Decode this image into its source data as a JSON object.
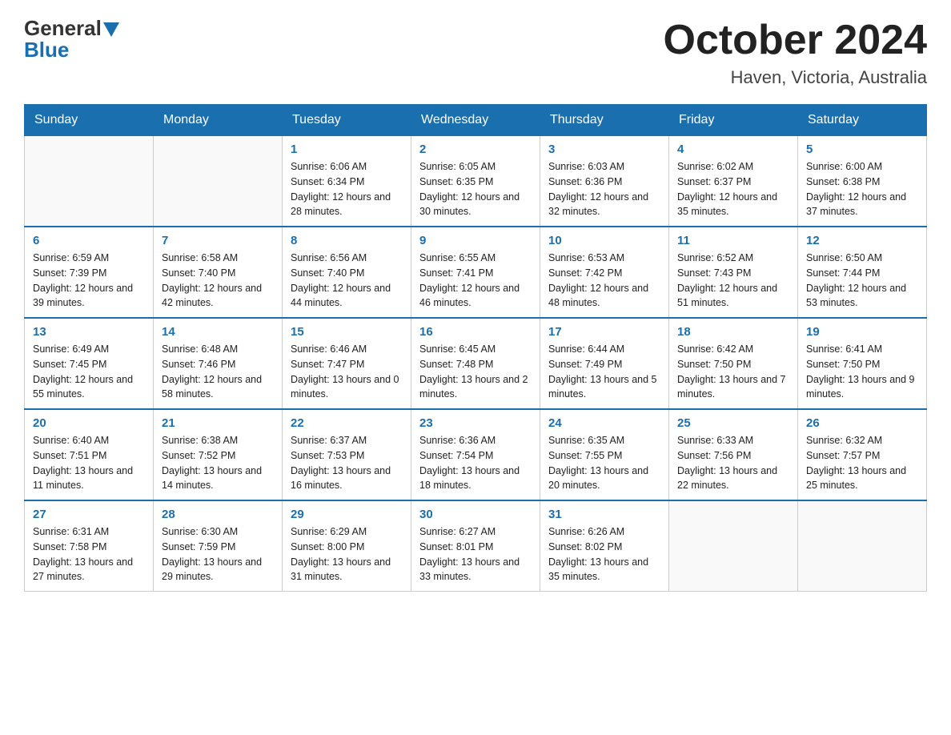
{
  "header": {
    "logo_general": "General",
    "logo_blue": "Blue",
    "month": "October 2024",
    "location": "Haven, Victoria, Australia"
  },
  "weekdays": [
    "Sunday",
    "Monday",
    "Tuesday",
    "Wednesday",
    "Thursday",
    "Friday",
    "Saturday"
  ],
  "weeks": [
    [
      {
        "day": "",
        "sunrise": "",
        "sunset": "",
        "daylight": ""
      },
      {
        "day": "",
        "sunrise": "",
        "sunset": "",
        "daylight": ""
      },
      {
        "day": "1",
        "sunrise": "Sunrise: 6:06 AM",
        "sunset": "Sunset: 6:34 PM",
        "daylight": "Daylight: 12 hours and 28 minutes."
      },
      {
        "day": "2",
        "sunrise": "Sunrise: 6:05 AM",
        "sunset": "Sunset: 6:35 PM",
        "daylight": "Daylight: 12 hours and 30 minutes."
      },
      {
        "day": "3",
        "sunrise": "Sunrise: 6:03 AM",
        "sunset": "Sunset: 6:36 PM",
        "daylight": "Daylight: 12 hours and 32 minutes."
      },
      {
        "day": "4",
        "sunrise": "Sunrise: 6:02 AM",
        "sunset": "Sunset: 6:37 PM",
        "daylight": "Daylight: 12 hours and 35 minutes."
      },
      {
        "day": "5",
        "sunrise": "Sunrise: 6:00 AM",
        "sunset": "Sunset: 6:38 PM",
        "daylight": "Daylight: 12 hours and 37 minutes."
      }
    ],
    [
      {
        "day": "6",
        "sunrise": "Sunrise: 6:59 AM",
        "sunset": "Sunset: 7:39 PM",
        "daylight": "Daylight: 12 hours and 39 minutes."
      },
      {
        "day": "7",
        "sunrise": "Sunrise: 6:58 AM",
        "sunset": "Sunset: 7:40 PM",
        "daylight": "Daylight: 12 hours and 42 minutes."
      },
      {
        "day": "8",
        "sunrise": "Sunrise: 6:56 AM",
        "sunset": "Sunset: 7:40 PM",
        "daylight": "Daylight: 12 hours and 44 minutes."
      },
      {
        "day": "9",
        "sunrise": "Sunrise: 6:55 AM",
        "sunset": "Sunset: 7:41 PM",
        "daylight": "Daylight: 12 hours and 46 minutes."
      },
      {
        "day": "10",
        "sunrise": "Sunrise: 6:53 AM",
        "sunset": "Sunset: 7:42 PM",
        "daylight": "Daylight: 12 hours and 48 minutes."
      },
      {
        "day": "11",
        "sunrise": "Sunrise: 6:52 AM",
        "sunset": "Sunset: 7:43 PM",
        "daylight": "Daylight: 12 hours and 51 minutes."
      },
      {
        "day": "12",
        "sunrise": "Sunrise: 6:50 AM",
        "sunset": "Sunset: 7:44 PM",
        "daylight": "Daylight: 12 hours and 53 minutes."
      }
    ],
    [
      {
        "day": "13",
        "sunrise": "Sunrise: 6:49 AM",
        "sunset": "Sunset: 7:45 PM",
        "daylight": "Daylight: 12 hours and 55 minutes."
      },
      {
        "day": "14",
        "sunrise": "Sunrise: 6:48 AM",
        "sunset": "Sunset: 7:46 PM",
        "daylight": "Daylight: 12 hours and 58 minutes."
      },
      {
        "day": "15",
        "sunrise": "Sunrise: 6:46 AM",
        "sunset": "Sunset: 7:47 PM",
        "daylight": "Daylight: 13 hours and 0 minutes."
      },
      {
        "day": "16",
        "sunrise": "Sunrise: 6:45 AM",
        "sunset": "Sunset: 7:48 PM",
        "daylight": "Daylight: 13 hours and 2 minutes."
      },
      {
        "day": "17",
        "sunrise": "Sunrise: 6:44 AM",
        "sunset": "Sunset: 7:49 PM",
        "daylight": "Daylight: 13 hours and 5 minutes."
      },
      {
        "day": "18",
        "sunrise": "Sunrise: 6:42 AM",
        "sunset": "Sunset: 7:50 PM",
        "daylight": "Daylight: 13 hours and 7 minutes."
      },
      {
        "day": "19",
        "sunrise": "Sunrise: 6:41 AM",
        "sunset": "Sunset: 7:50 PM",
        "daylight": "Daylight: 13 hours and 9 minutes."
      }
    ],
    [
      {
        "day": "20",
        "sunrise": "Sunrise: 6:40 AM",
        "sunset": "Sunset: 7:51 PM",
        "daylight": "Daylight: 13 hours and 11 minutes."
      },
      {
        "day": "21",
        "sunrise": "Sunrise: 6:38 AM",
        "sunset": "Sunset: 7:52 PM",
        "daylight": "Daylight: 13 hours and 14 minutes."
      },
      {
        "day": "22",
        "sunrise": "Sunrise: 6:37 AM",
        "sunset": "Sunset: 7:53 PM",
        "daylight": "Daylight: 13 hours and 16 minutes."
      },
      {
        "day": "23",
        "sunrise": "Sunrise: 6:36 AM",
        "sunset": "Sunset: 7:54 PM",
        "daylight": "Daylight: 13 hours and 18 minutes."
      },
      {
        "day": "24",
        "sunrise": "Sunrise: 6:35 AM",
        "sunset": "Sunset: 7:55 PM",
        "daylight": "Daylight: 13 hours and 20 minutes."
      },
      {
        "day": "25",
        "sunrise": "Sunrise: 6:33 AM",
        "sunset": "Sunset: 7:56 PM",
        "daylight": "Daylight: 13 hours and 22 minutes."
      },
      {
        "day": "26",
        "sunrise": "Sunrise: 6:32 AM",
        "sunset": "Sunset: 7:57 PM",
        "daylight": "Daylight: 13 hours and 25 minutes."
      }
    ],
    [
      {
        "day": "27",
        "sunrise": "Sunrise: 6:31 AM",
        "sunset": "Sunset: 7:58 PM",
        "daylight": "Daylight: 13 hours and 27 minutes."
      },
      {
        "day": "28",
        "sunrise": "Sunrise: 6:30 AM",
        "sunset": "Sunset: 7:59 PM",
        "daylight": "Daylight: 13 hours and 29 minutes."
      },
      {
        "day": "29",
        "sunrise": "Sunrise: 6:29 AM",
        "sunset": "Sunset: 8:00 PM",
        "daylight": "Daylight: 13 hours and 31 minutes."
      },
      {
        "day": "30",
        "sunrise": "Sunrise: 6:27 AM",
        "sunset": "Sunset: 8:01 PM",
        "daylight": "Daylight: 13 hours and 33 minutes."
      },
      {
        "day": "31",
        "sunrise": "Sunrise: 6:26 AM",
        "sunset": "Sunset: 8:02 PM",
        "daylight": "Daylight: 13 hours and 35 minutes."
      },
      {
        "day": "",
        "sunrise": "",
        "sunset": "",
        "daylight": ""
      },
      {
        "day": "",
        "sunrise": "",
        "sunset": "",
        "daylight": ""
      }
    ]
  ]
}
